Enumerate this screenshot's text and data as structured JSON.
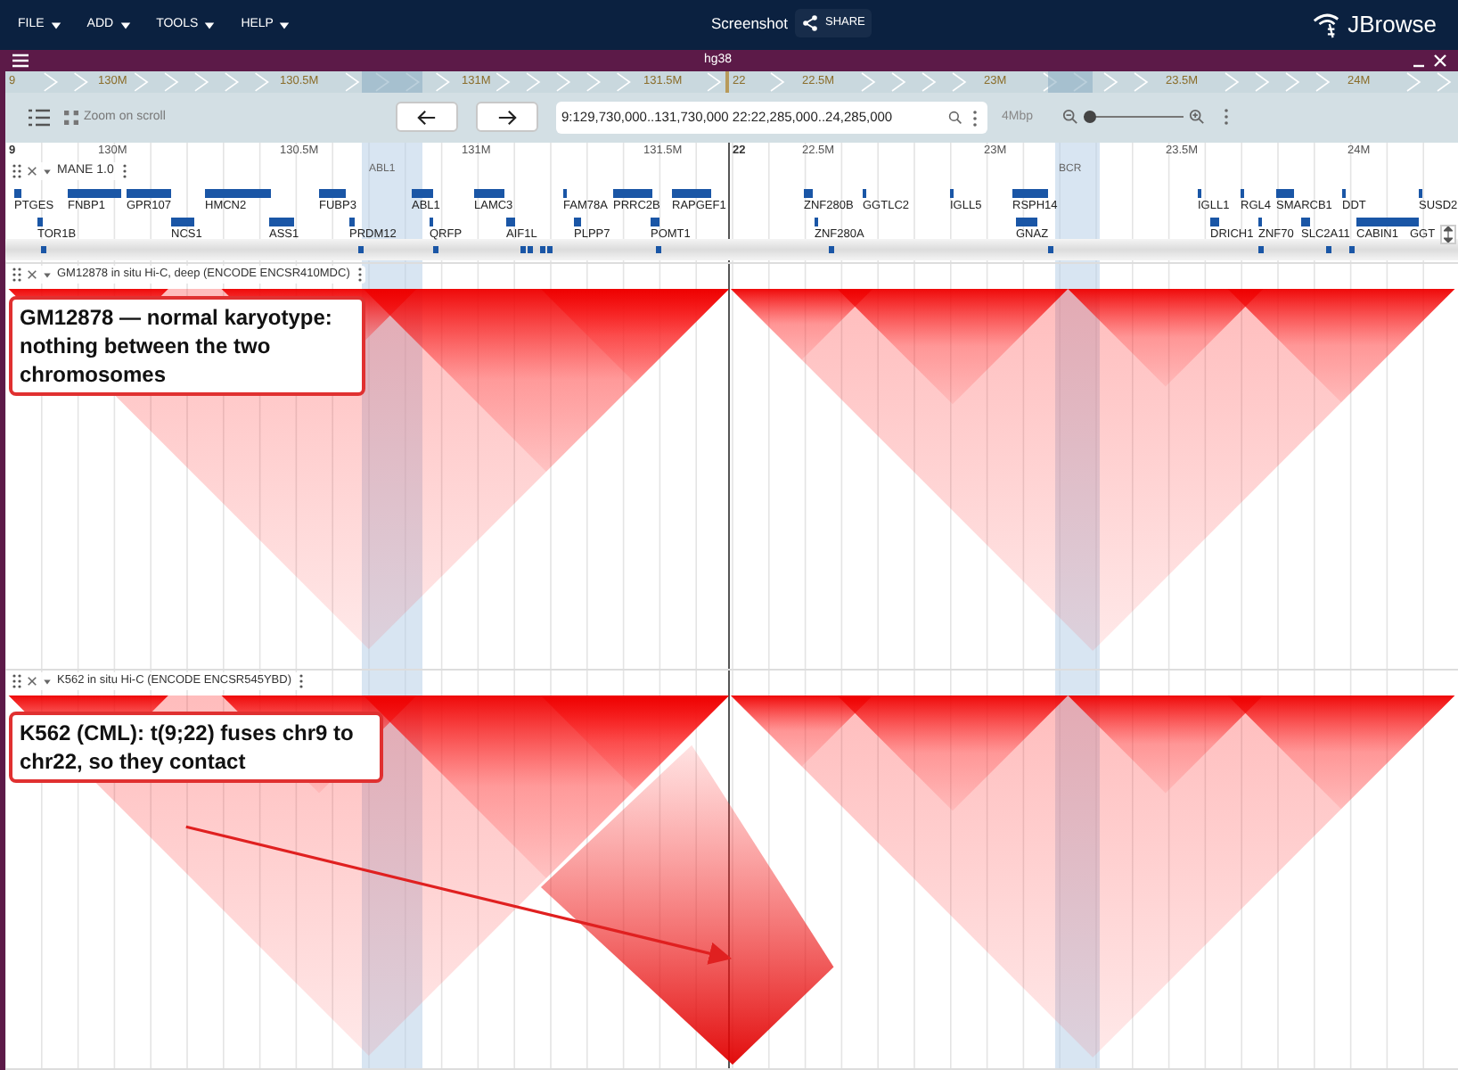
{
  "app_bar": {
    "menus": [
      "FILE",
      "ADD",
      "TOOLS",
      "HELP"
    ],
    "title": "Screenshot",
    "share": "SHARE",
    "logo": "JBrowse"
  },
  "view": {
    "title": "hg38"
  },
  "overview": {
    "panels": [
      {
        "ref": "9",
        "ticks": [
          "130M",
          "130.5M",
          "131M",
          "131.5M"
        ]
      },
      {
        "ref": "22",
        "ticks": [
          "22.5M",
          "23M",
          "23.5M",
          "24M"
        ]
      }
    ]
  },
  "toolbar": {
    "zoom_toggle": "Zoom on scroll",
    "location": "9:129,730,000..131,730,000 22:22,285,000..24,285,000",
    "span": "4Mbp",
    "zoom": {
      "level": 0.06
    }
  },
  "ruler": {
    "panels": [
      {
        "ref": "9",
        "ticks": [
          "130M",
          "130.5M",
          "131M",
          "131.5M"
        ],
        "highlight": "ABL1"
      },
      {
        "ref": "22",
        "ticks": [
          "22.5M",
          "23M",
          "23.5M",
          "24M"
        ],
        "highlight": "BCR"
      }
    ]
  },
  "tracks": [
    {
      "kind": "genes",
      "name": "MANE 1.0",
      "panels": [
        {
          "genes": [
            "PTGES",
            "FNBP1",
            "GPR107",
            "HMCN2",
            "FUBP3",
            "ABL1",
            "LAMC3",
            "FAM78A",
            "PRRC2B",
            "RAPGEF1",
            "TOR1B",
            "NCS1",
            "ASS1",
            "PRDM12",
            "QRFP",
            "AIF1L",
            "PLPP7",
            "POMT1"
          ]
        },
        {
          "genes": [
            "ZNF280B",
            "GGTLC2",
            "IGLL5",
            "RSPH14",
            "IGLL1",
            "RGL4",
            "SMARCB1",
            "DDT",
            "SUSD2",
            "ZNF280A",
            "GNAZ",
            "DRICH1",
            "ZNF70",
            "SLC2A11",
            "CABIN1",
            "GGT"
          ]
        }
      ]
    },
    {
      "kind": "hic",
      "name": "GM12878 in situ Hi-C, deep (ENCODE ENCSR410MDC)",
      "annotation": "GM12878 — normal karyotype: nothing between the two chromosomes",
      "translocation": false
    },
    {
      "kind": "hic",
      "name": "K562 in situ Hi-C (ENCODE ENCSR545YBD)",
      "annotation": "K562 (CML): t(9;22) fuses chr9 to chr22, so they contact",
      "translocation": true
    }
  ]
}
